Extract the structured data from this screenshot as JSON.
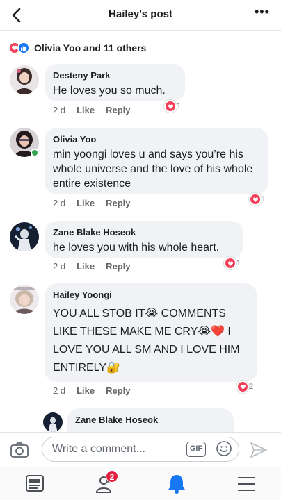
{
  "header": {
    "title": "Hailey's post",
    "more_label": "•••"
  },
  "reactions": {
    "summary": "Olivia Yoo and 11 others"
  },
  "comments": [
    {
      "author": "Desteny Park",
      "text": "He loves you so much.",
      "time": "2 d",
      "like_label": "Like",
      "reply_label": "Reply",
      "love_count": "1"
    },
    {
      "author": "Olivia Yoo",
      "text": "min yoongi loves u and says you’re his whole universe and the love of his whole entire existence",
      "time": "2 d",
      "like_label": "Like",
      "reply_label": "Reply",
      "love_count": "1"
    },
    {
      "author": "Zane Blake Hoseok",
      "text": "he loves you with his whole heart.",
      "time": "2 d",
      "like_label": "Like",
      "reply_label": "Reply",
      "love_count": "1"
    },
    {
      "author": "Hailey Yoongi",
      "text": "YOU ALL STOB IT😭 COMMENTS LIKE THESE MAKE ME CRY😭❤️ I LOVE YOU ALL SM AND I LOVE HIM ENTIRELY🔐",
      "time": "2 d",
      "like_label": "Like",
      "reply_label": "Reply",
      "love_count": "2"
    },
    {
      "author": "Zane Blake Hoseok"
    }
  ],
  "composer": {
    "placeholder": "Write a comment...",
    "gif_label": "GIF"
  },
  "bottom_nav": {
    "notifications_badge": "2"
  },
  "colors": {
    "accent": "#1877f2",
    "love": "#f33e58",
    "badge": "#e41e3f"
  }
}
